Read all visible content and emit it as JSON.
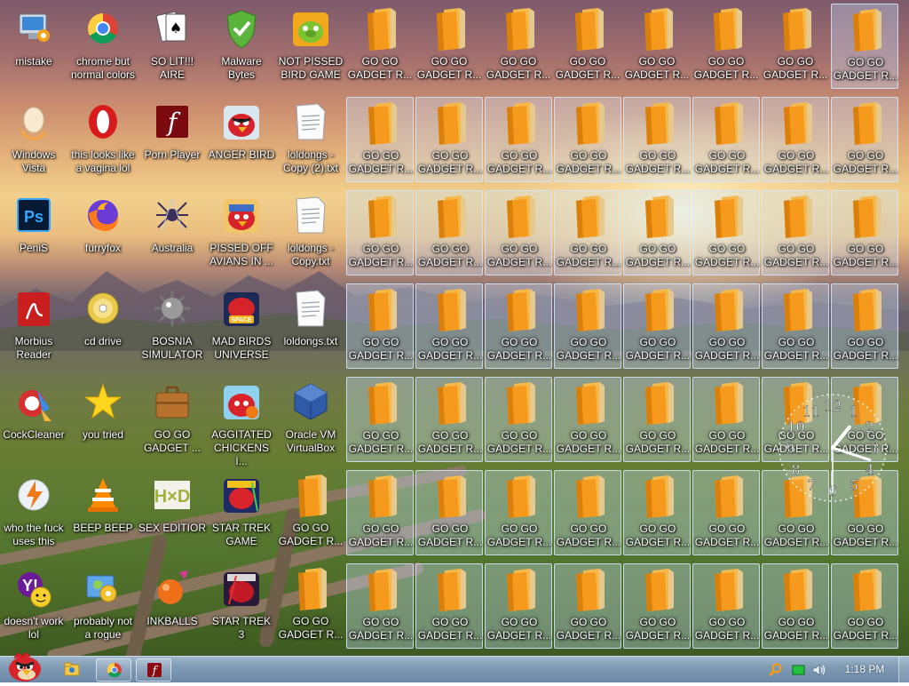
{
  "desktop": {
    "col1": [
      {
        "label": "mistake",
        "icon": "computer-settings-icon"
      },
      {
        "label": "Windows Vista",
        "icon": "egg-icon"
      },
      {
        "label": "PeniS",
        "icon": "photoshop-icon"
      },
      {
        "label": "Morbius Reader",
        "icon": "acrobat-reader-icon"
      },
      {
        "label": "CockCleaner",
        "icon": "ccleaner-icon"
      },
      {
        "label": "who the fuck uses this",
        "icon": "winamp-bolt-icon"
      },
      {
        "label": "doesn't work lol",
        "icon": "yahoo-messenger-icon"
      }
    ],
    "col2": [
      {
        "label": "chrome but normal colors",
        "icon": "chrome-icon"
      },
      {
        "label": "this looks like a vagina lol",
        "icon": "opera-icon"
      },
      {
        "label": "furryfox",
        "icon": "firefox-icon"
      },
      {
        "label": "cd drive",
        "icon": "cd-drive-icon"
      },
      {
        "label": "you tried",
        "icon": "star-icon"
      },
      {
        "label": "BEEP BEEP",
        "icon": "vlc-cone-icon"
      },
      {
        "label": "probably not a rogue",
        "icon": "control-panel-icon"
      }
    ],
    "col3": [
      {
        "label": "SO LIT!!! AIRE",
        "icon": "solitaire-cards-icon"
      },
      {
        "label": "Porn Player",
        "icon": "flash-player-icon"
      },
      {
        "label": "Australia",
        "icon": "spider-solitaire-icon"
      },
      {
        "label": "BOSNIA SIMULATOR",
        "icon": "minesweeper-mine-icon"
      },
      {
        "label": "GO GO GADGET ...",
        "icon": "briefcase-icon"
      },
      {
        "label": "SEX EDITIOR",
        "icon": "hxd-editor-icon"
      },
      {
        "label": "INKBALLS",
        "icon": "inkball-icon"
      }
    ],
    "col4": [
      {
        "label": "Malware Bytes",
        "icon": "shield-check-icon"
      },
      {
        "label": "ANGER BIRD",
        "icon": "angry-bird-icon"
      },
      {
        "label": "PISSED OFF AVIANS IN ...",
        "icon": "angry-birds-seasons-icon"
      },
      {
        "label": "MAD BIRDS UNIVERSE",
        "icon": "angry-birds-space-icon"
      },
      {
        "label": "AGGITATED CHICKENS I...",
        "icon": "angry-birds-rio-icon"
      },
      {
        "label": "STAR TREK GAME",
        "icon": "angry-birds-star-wars-icon"
      },
      {
        "label": "STAR TREK 3",
        "icon": "angry-birds-star-wars-2-icon"
      }
    ],
    "col5": [
      {
        "label": "NOT PISSED BIRD GAME",
        "icon": "bad-piggies-icon"
      },
      {
        "label": "loldongs - Copy (2).txt",
        "icon": "text-file-icon"
      },
      {
        "label": "loldongs - Copy.txt",
        "icon": "text-file-icon"
      },
      {
        "label": "loldongs.txt",
        "icon": "text-file-icon"
      },
      {
        "label": "Oracle VM VirtualBox",
        "icon": "virtualbox-icon"
      },
      {
        "label": "GO GO GADGET R...",
        "icon": "folder-icon"
      },
      {
        "label": "GO GO GADGET R...",
        "icon": "folder-icon"
      }
    ],
    "folder_label": "GO GO GADGET R..."
  },
  "clock_gadget": {
    "numerals": [
      "12",
      "1",
      "2",
      "3",
      "4",
      "5",
      "6",
      "7",
      "8",
      "9",
      "10",
      "11"
    ]
  },
  "taskbar": {
    "start_icon": "angry-bird-start-icon",
    "pinned": [
      {
        "name": "explorer-folder-icon"
      },
      {
        "name": "chrome-icon"
      },
      {
        "name": "flash-player-icon"
      }
    ],
    "tray": [
      "search-magnifier-icon",
      "green-battery-icon",
      "speaker-icon"
    ],
    "time": "1:18 PM"
  },
  "colors": {
    "taskbar": "#7f9ab5",
    "folder_orange": "#f5a020",
    "selection": "#c8e1ff"
  }
}
